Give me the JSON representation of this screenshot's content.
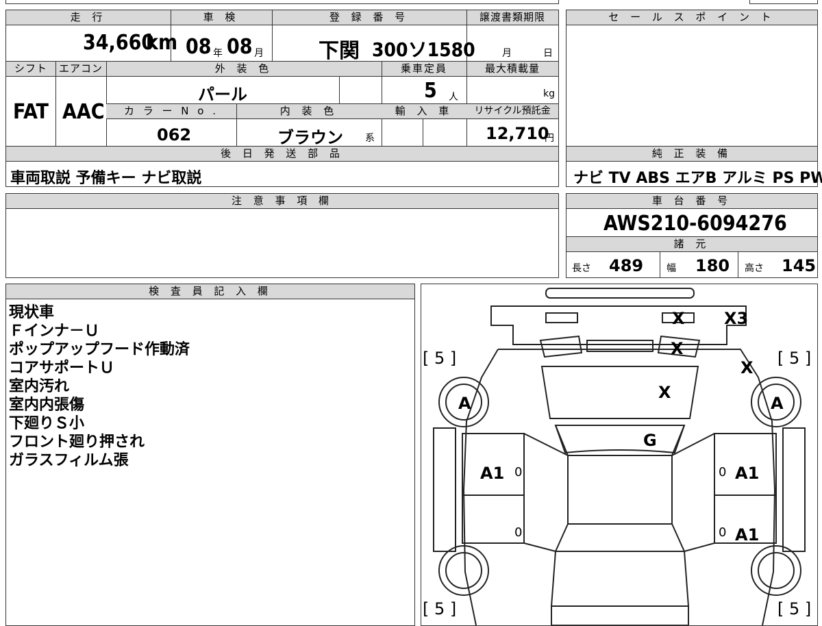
{
  "headers": {
    "mileage": "走 行",
    "inspection": "車 検",
    "registration": "登 録 番 号",
    "transfer_deadline": "譲渡書類期限",
    "sales_point": "セ ー ル ス ポ イ ン ト",
    "shift": "シフト",
    "aircon": "エアコン",
    "exterior_color": "外 装 色",
    "capacity": "乗車定員",
    "max_load": "最大積載量",
    "color_no": "カ ラ ー N o .",
    "interior_color": "内 装 色",
    "import": "輸 入 車",
    "recycle": "リサイクル預託金",
    "later_parts": "後 日 発 送 部 品",
    "genuine_equipment": "純 正 装 備",
    "notes": "注 意 事 項 欄",
    "chassis_no": "車 台 番 号",
    "specs": "諸 元",
    "inspector": "検 査 員 記 入 欄"
  },
  "vehicle": {
    "mileage_value": "34,660",
    "mileage_unit": "km",
    "inspection_year": "08",
    "year_unit": "年",
    "inspection_month": "08",
    "month_unit": "月",
    "registration_area": "下関",
    "registration_number": "300ソ1580",
    "deadline_month_unit": "月",
    "deadline_day_unit": "日",
    "shift": "FAT",
    "aircon": "AAC",
    "exterior_color": "パール",
    "capacity": "5",
    "capacity_unit": "人",
    "max_load_unit": "kg",
    "color_no": "062",
    "interior_color": "ブラウン",
    "interior_suffix": "系",
    "recycle_fee": "12,710",
    "recycle_unit": "円",
    "later_parts": "車両取説 予備キー ナビ取説",
    "genuine_equipment": "ナビ TV ABS エアB アルミ PS PW",
    "chassis_no": "AWS210-6094276",
    "length_label": "長さ",
    "length": "489",
    "width_label": "幅",
    "width": "180",
    "height_label": "高さ",
    "height": "145"
  },
  "inspector_notes": [
    "現状車",
    "Ｆインナ－Ｕ",
    "ポップアップフード作動済",
    "コアサポートＵ",
    "室内汚れ",
    "室内内張傷",
    "下廻りＳ小",
    "フロント廻り押され",
    "ガラスフィルム張"
  ],
  "diagram": {
    "tire_tread_fl": "[ 5 ]",
    "tire_tread_fr": "[ 5 ]",
    "tire_tread_rl": "[ 5 ]",
    "tire_tread_rr": "[ 5 ]",
    "wheel_left": "A",
    "wheel_right": "A",
    "bumper_mark": "X",
    "bumper_count": "X3",
    "grille_mark": "X",
    "fender_right_mark": "X",
    "hood_mark": "X",
    "windshield_mark": "G",
    "front_door_left": "A1",
    "front_door_right": "A1",
    "rear_door_right": "A1",
    "zero_1": "0",
    "zero_2": "0",
    "zero_3": "0",
    "zero_4": "0"
  }
}
